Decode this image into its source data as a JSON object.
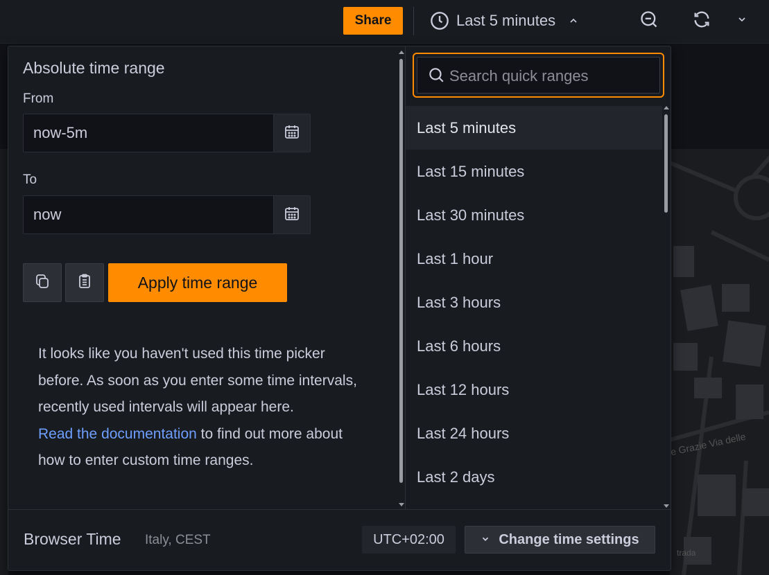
{
  "toolbar": {
    "share_label": "Share",
    "time_range_label": "Last 5 minutes"
  },
  "picker": {
    "title": "Absolute time range",
    "from_label": "From",
    "from_value": "now-5m",
    "to_label": "To",
    "to_value": "now",
    "apply_label": "Apply time range",
    "help_text": "It looks like you haven't used this time picker before. As soon as you enter some time intervals, recently used intervals will appear here.",
    "help_link": "Read the documentation",
    "help_suffix": " to find out more about how to enter custom time ranges."
  },
  "quick": {
    "search_placeholder": "Search quick ranges",
    "ranges": [
      {
        "label": "Last 5 minutes"
      },
      {
        "label": "Last 15 minutes"
      },
      {
        "label": "Last 30 minutes"
      },
      {
        "label": "Last 1 hour"
      },
      {
        "label": "Last 3 hours"
      },
      {
        "label": "Last 6 hours"
      },
      {
        "label": "Last 12 hours"
      },
      {
        "label": "Last 24 hours"
      },
      {
        "label": "Last 2 days"
      }
    ]
  },
  "footer": {
    "timezone_label": "Browser Time",
    "timezone_zone": "Italy, CEST",
    "utc_offset": "UTC+02:00",
    "change_label": "Change time settings"
  },
  "map": {
    "street_label": "e Grazie  Via delle",
    "street_label2": "trada"
  },
  "colors": {
    "accent": "#ff8c00",
    "link": "#6e9fff",
    "panel_bg": "#181b1f"
  }
}
